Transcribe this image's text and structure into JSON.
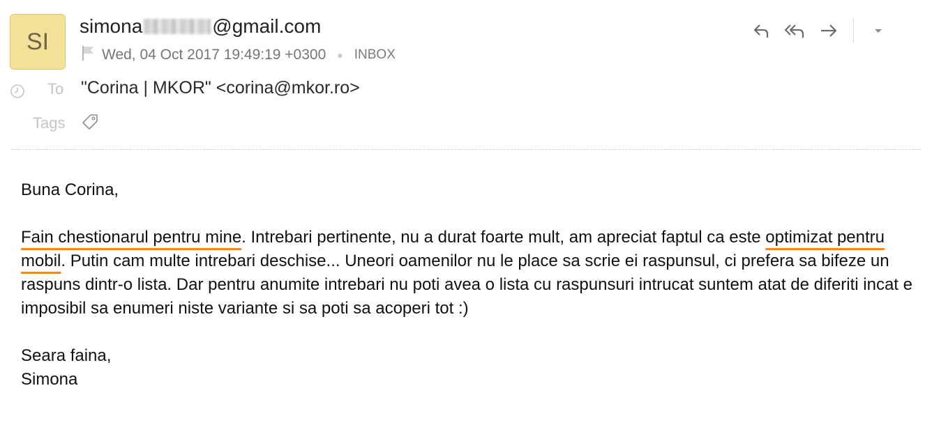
{
  "avatar": {
    "initials": "SI",
    "color": "#f3e19a"
  },
  "sender": {
    "name_start": "simona",
    "name_end": "@gmail.com"
  },
  "meta": {
    "date": "Wed, 04 Oct 2017 19:49:19 +0300",
    "folder": "INBOX",
    "flag_icon": "flag-icon"
  },
  "to": {
    "label": "To",
    "value": "\"Corina | MKOR\" <corina@mkor.ro>"
  },
  "tags": {
    "label": "Tags",
    "icon": "tag-icon"
  },
  "actions": [
    {
      "name": "reply",
      "icon": "reply-icon"
    },
    {
      "name": "reply-all",
      "icon": "reply-all-icon"
    },
    {
      "name": "forward",
      "icon": "forward-icon"
    },
    {
      "name": "more",
      "icon": "chevron-down-icon"
    }
  ],
  "message": {
    "greeting": "Buna Corina,",
    "highlight_1": "Fain chestionarul pentru mine",
    "text_1": ". Intrebari pertinente, nu a durat foarte mult, am apreciat faptul ca este ",
    "highlight_2": "optimizat pentru mobil",
    "text_2": ". Putin cam multe intrebari deschise... Uneori oamenilor nu le place sa scrie ei raspunsul, ci prefera sa bifeze un raspuns dintr-o lista. Dar pentru anumite intrebari nu poti avea o lista cu raspunsuri intrucat suntem atat de diferiti incat e imposibil sa enumeri niste variante si sa poti sa acoperi tot :)",
    "closing": "Seara faina,",
    "signature": "Simona"
  },
  "colors": {
    "highlight_underline": "#f08a1c",
    "muted_text": "#767676"
  }
}
